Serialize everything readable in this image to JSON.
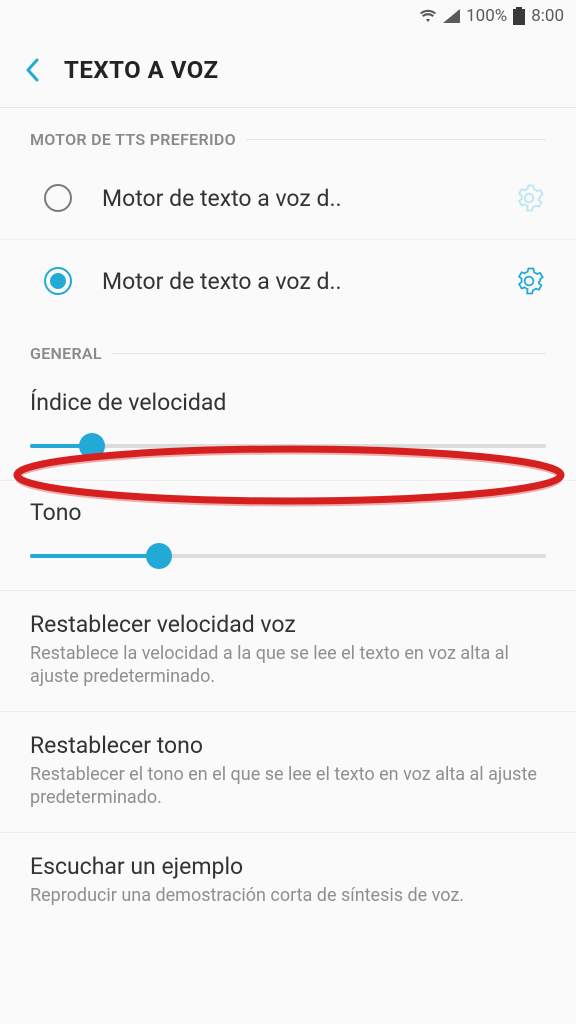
{
  "status": {
    "battery": "100%",
    "time": "8:00"
  },
  "header": {
    "title": "TEXTO A VOZ"
  },
  "tts_section": {
    "label": "MOTOR DE TTS PREFERIDO",
    "engines": [
      {
        "label": "Motor de texto a voz d..",
        "selected": false
      },
      {
        "label": "Motor de texto a voz d..",
        "selected": true
      }
    ]
  },
  "general": {
    "label": "GENERAL",
    "speed": {
      "label": "Índice de velocidad",
      "value": 12
    },
    "tone": {
      "label": "Tono",
      "value": 25
    },
    "reset_speed": {
      "title": "Restablecer velocidad voz",
      "desc": "Restablece la velocidad a la que se lee el texto en voz alta al ajuste predeterminado."
    },
    "reset_tone": {
      "title": "Restablecer tono",
      "desc": "Restablecer el tono en el que se lee el texto en voz alta al ajuste predeterminado."
    },
    "listen": {
      "title": "Escuchar un ejemplo",
      "desc": "Reproducir una demostración corta de síntesis de voz."
    }
  },
  "colors": {
    "accent": "#23a9d6",
    "annot": "#d61f1f"
  }
}
